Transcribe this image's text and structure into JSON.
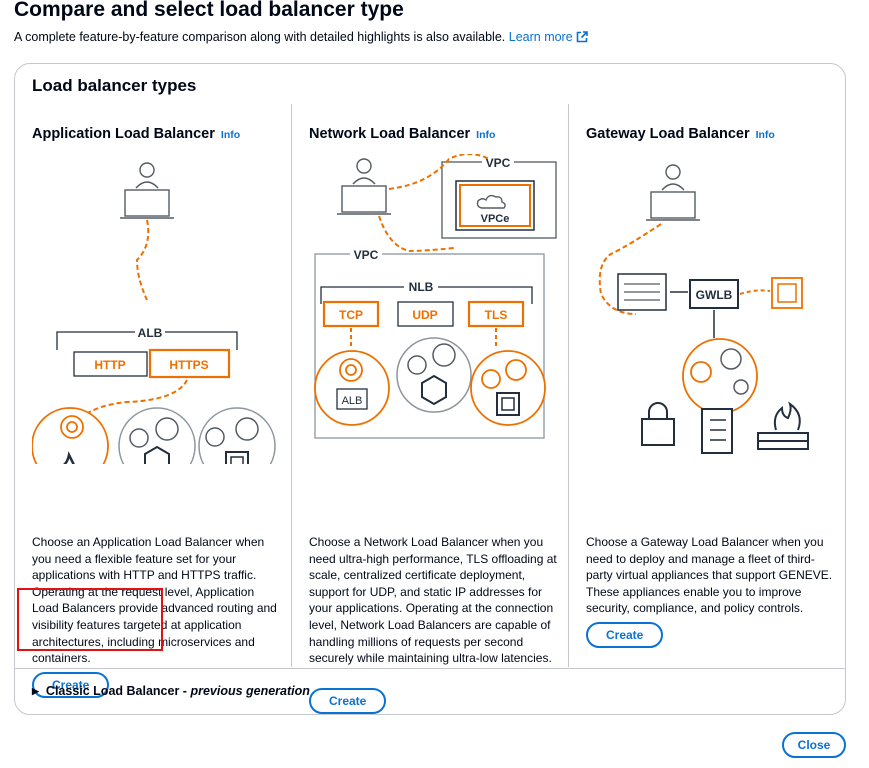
{
  "page": {
    "title": "Compare and select load balancer type",
    "description": "A complete feature-by-feature comparison along with detailed highlights is also available.",
    "learn_more": "Learn more"
  },
  "panel": {
    "heading": "Load balancer types"
  },
  "load_balancers": [
    {
      "title": "Application Load Balancer",
      "info": "Info",
      "diagram_labels": [
        "ALB",
        "HTTP",
        "HTTPS"
      ],
      "description": "Choose an Application Load Balancer when you need a flexible feature set for your applications with HTTP and HTTPS traffic. Operating at the request level, Application Load Balancers provide advanced routing and visibility features targeted at application architectures, including microservices and containers.",
      "create": "Create"
    },
    {
      "title": "Network Load Balancer",
      "info": "Info",
      "diagram_labels": [
        "VPC",
        "VPCe",
        "VPC",
        "NLB",
        "TCP",
        "UDP",
        "TLS",
        "ALB"
      ],
      "description": "Choose a Network Load Balancer when you need ultra-high performance, TLS offloading at scale, centralized certificate deployment, support for UDP, and static IP addresses for your applications. Operating at the connection level, Network Load Balancers are capable of handling millions of requests per second securely while maintaining ultra-low latencies.",
      "create": "Create"
    },
    {
      "title": "Gateway Load Balancer",
      "info": "Info",
      "diagram_labels": [
        "GWLB"
      ],
      "description": "Choose a Gateway Load Balancer when you need to deploy and manage a fleet of third-party virtual appliances that support GENEVE. These appliances enable you to improve security, compliance, and policy controls.",
      "create": "Create"
    }
  ],
  "classic": {
    "label": "Classic Load Balancer - ",
    "suffix": "previous generation"
  },
  "footer": {
    "close": "Close"
  },
  "colors": {
    "accent": "#0972d3",
    "orange": "#ed7100",
    "highlight": "#e01212",
    "border": "#c6c6cd"
  }
}
